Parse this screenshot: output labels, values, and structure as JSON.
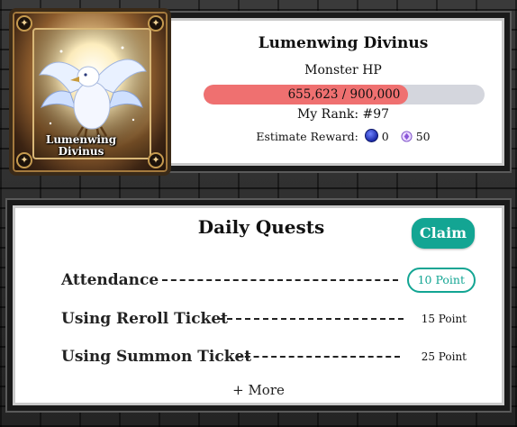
{
  "boss": {
    "card_name_line1": "Lumenwing",
    "card_name_line2": "Divinus",
    "name": "Lumenwing Divinus",
    "hp_label": "Monster HP",
    "hp_current": 655623,
    "hp_max": 900000,
    "hp_text": "655,623 / 900,000",
    "rank_text": "My Rank: #97",
    "reward_label": "Estimate Reward:",
    "reward_coin_value": "0",
    "reward_gem_value": "50",
    "icons": {
      "coin": "blue-coin-icon",
      "gem": "purple-gem-icon"
    },
    "colors": {
      "hp_fill": "#ef7070",
      "hp_track": "#d4d6dd"
    }
  },
  "daily_quests": {
    "title": "Daily Quests",
    "claim_label": "Claim",
    "accent_color": "#13a593",
    "items": [
      {
        "name": "Attendance",
        "points": "10 Point",
        "claimable": true
      },
      {
        "name": "Using Reroll Ticket",
        "points": "15 Point",
        "claimable": false
      },
      {
        "name": "Using Summon Ticket",
        "points": "25 Point",
        "claimable": false
      }
    ],
    "more_label": "+ More"
  }
}
